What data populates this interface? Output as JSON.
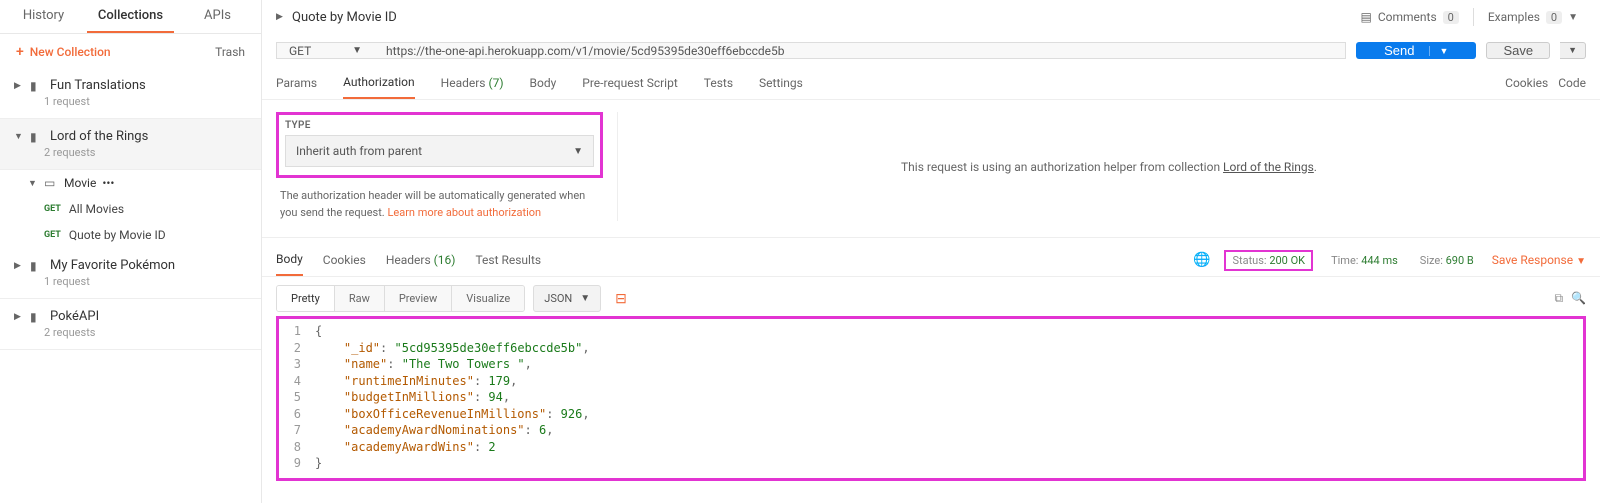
{
  "sidebar": {
    "tabs": [
      "History",
      "Collections",
      "APIs"
    ],
    "activeTab": 1,
    "newCollection": "New Collection",
    "trash": "Trash",
    "collections": [
      {
        "name": "Fun Translations",
        "sub": "1 request",
        "open": false
      },
      {
        "name": "Lord of the Rings",
        "sub": "2 requests",
        "open": true,
        "folders": [
          {
            "name": "Movie",
            "requests": [
              {
                "method": "GET",
                "name": "All Movies"
              },
              {
                "method": "GET",
                "name": "Quote by Movie ID"
              }
            ]
          }
        ]
      },
      {
        "name": "My Favorite Pokémon",
        "sub": "1 request",
        "open": false
      },
      {
        "name": "PokéAPI",
        "sub": "2 requests",
        "open": false
      }
    ]
  },
  "topbar": {
    "breadcrumb": "Quote by Movie ID",
    "comments": {
      "label": "Comments",
      "count": "0"
    },
    "examples": {
      "label": "Examples",
      "count": "0"
    }
  },
  "request": {
    "method": "GET",
    "url": "https://the-one-api.herokuapp.com/v1/movie/5cd95395de30eff6ebccde5b",
    "send": "Send",
    "save": "Save",
    "tabs": {
      "params": "Params",
      "auth": "Authorization",
      "headers": "Headers",
      "headersCount": "(7)",
      "body": "Body",
      "prescript": "Pre-request Script",
      "tests": "Tests",
      "settings": "Settings"
    },
    "cookies": "Cookies",
    "code": "Code"
  },
  "auth": {
    "typeLabel": "TYPE",
    "selected": "Inherit auth from parent",
    "desc1": "The authorization header will be automatically generated when you send the request. ",
    "learnMore": "Learn more about authorization",
    "msgPrefix": "This request is using an authorization helper from collection ",
    "msgLink": "Lord of the Rings",
    "msgSuffix": "."
  },
  "response": {
    "tabs": {
      "body": "Body",
      "cookies": "Cookies",
      "headers": "Headers",
      "headersCount": "(16)",
      "testResults": "Test Results"
    },
    "status": {
      "label": "Status:",
      "value": "200 OK"
    },
    "time": {
      "label": "Time:",
      "value": "444 ms"
    },
    "size": {
      "label": "Size:",
      "value": "690 B"
    },
    "save": "Save Response",
    "views": {
      "pretty": "Pretty",
      "raw": "Raw",
      "preview": "Preview",
      "visualize": "Visualize"
    },
    "format": "JSON",
    "body": {
      "_id": "5cd95395de30eff6ebccde5b",
      "name": "The Two Towers ",
      "runtimeInMinutes": 179,
      "budgetInMillions": 94,
      "boxOfficeRevenueInMillions": 926,
      "academyAwardNominations": 6,
      "academyAwardWins": 2
    }
  },
  "chart_data": null
}
